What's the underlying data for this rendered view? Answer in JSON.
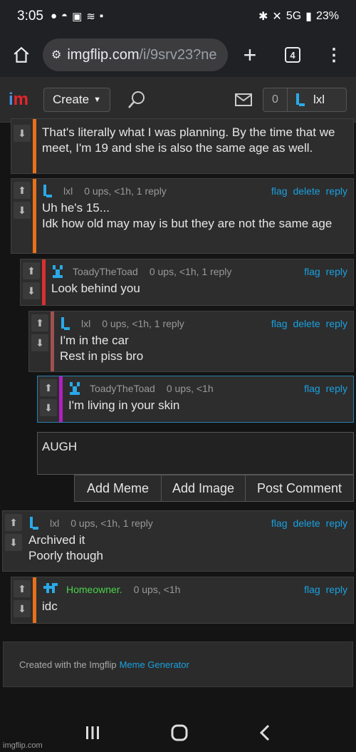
{
  "status_bar": {
    "time": "3:05",
    "signal": "5G",
    "battery": "23%"
  },
  "browser": {
    "url_host": "imgflip.com",
    "url_path": "/i/9srv23?ne",
    "tab_count": "4"
  },
  "site_header": {
    "create_label": "Create",
    "notif_count": "0",
    "username": "lxl"
  },
  "comments": [
    {
      "text": "That's literally what I was planning. By the time that we meet, I'm 19 and she is also the same age as well.",
      "bar_color": "#e8701a"
    },
    {
      "user": "lxl",
      "meta": "0 ups, <1h, 1 reply",
      "actions": [
        "flag",
        "delete",
        "reply"
      ],
      "text_lines": [
        "Uh he's 15...",
        "Idk how old may may is but they are not the same age"
      ],
      "bar_color": "#e8701a"
    },
    {
      "user": "ToadyTheToad",
      "meta": "0 ups, <1h, 1 reply",
      "actions": [
        "flag",
        "reply"
      ],
      "text_lines": [
        "Look behind you"
      ],
      "bar_color": "#d93030"
    },
    {
      "user": "lxl",
      "meta": "0 ups, <1h, 1 reply",
      "actions": [
        "flag",
        "delete",
        "reply"
      ],
      "text_lines": [
        "I'm in the car",
        "Rest in piss bro"
      ],
      "bar_color": "#a05050"
    },
    {
      "user": "ToadyTheToad",
      "meta": "0 ups, <1h",
      "actions": [
        "flag",
        "reply"
      ],
      "text_lines": [
        "I'm living in your skin"
      ],
      "bar_color": "#b020c0"
    },
    {
      "user": "lxl",
      "meta": "0 ups, <1h, 1 reply",
      "actions": [
        "flag",
        "delete",
        "reply"
      ],
      "text_lines": [
        "Archived it",
        "Poorly though"
      ],
      "bar_color": null
    },
    {
      "user": "Homeowner.",
      "meta": "0 ups, <1h",
      "actions": [
        "flag",
        "reply"
      ],
      "text_lines": [
        "idc"
      ],
      "bar_color": "#e8701a",
      "user_color": "#4bd44b"
    }
  ],
  "reply_box": {
    "value": "AUGH",
    "buttons": [
      "Add Meme",
      "Add Image",
      "Post Comment"
    ]
  },
  "footer": {
    "prefix": "Created with the Imgflip",
    "link": "Meme Generator"
  },
  "watermark": "imgflip.com"
}
